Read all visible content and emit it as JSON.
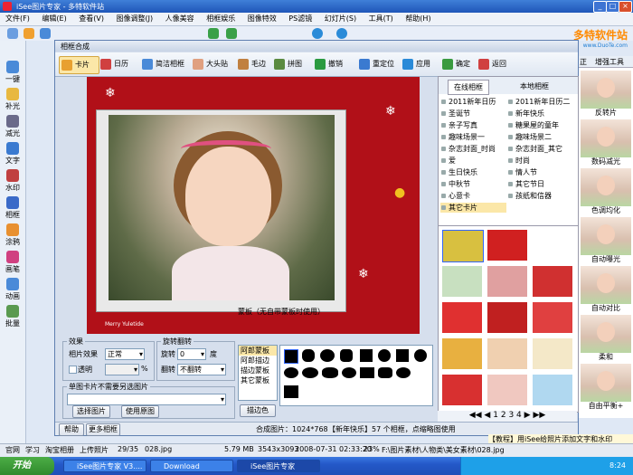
{
  "window": {
    "title": "iSee图片专家 - 多特软件站"
  },
  "menu": [
    "文件(F)",
    "编辑(E)",
    "查看(V)",
    "图像调整(J)",
    "人像美容",
    "相框娱乐",
    "图像特效",
    "PS滤镜",
    "幻灯片(S)",
    "工具(T)",
    "帮助(H)"
  ],
  "logo": {
    "main": "多特软件站",
    "sub": "www.DuoTe.com"
  },
  "left_tools": [
    "一键",
    "补光",
    "减光",
    "文字",
    "水印",
    "相框",
    "涂鸦",
    "画笔",
    "动画",
    "批量"
  ],
  "right_panel": {
    "tabs": [
      "正",
      "增强工具"
    ],
    "items": [
      "反转片",
      "数码减光",
      "色调均化",
      "自动曝光",
      "自动对比",
      "柔和",
      "自由平衡+"
    ]
  },
  "dialog": {
    "title": "相框合成",
    "tools": [
      "卡片",
      "日历",
      "简洁相框",
      "大头贴",
      "毛边",
      "拼图",
      "撤销",
      "重定位",
      "应用",
      "确定",
      "返回"
    ],
    "effect": {
      "legend": "效果",
      "label": "相片效果",
      "value": "正常",
      "transparent": "透明",
      "percent": "%"
    },
    "rotate": {
      "legend": "旋转翻转",
      "rotate_label": "旋转",
      "rotate_value": "0",
      "degree": "度",
      "flip_label": "翻转",
      "flip_value": "不翻转"
    },
    "card": {
      "legend": "单图卡片不需要另选图片",
      "choose": "选择图片",
      "use_original": "使用原图"
    },
    "mask": {
      "legend": "蒙板（无自带蒙板时使用）",
      "items": [
        "阿郎蒙板",
        "阿郎描边",
        "描边蒙板",
        "其它蒙板"
      ],
      "edge_color": "描边色"
    },
    "category_tabs": [
      "在线相框",
      "本地相框"
    ],
    "categories": [
      "2011新年日历",
      "2011新年日历二",
      "圣诞节",
      "新年快乐",
      "亲子写真",
      "糖果屋的童年",
      "趣味场景一",
      "趣味场景二",
      "杂志封面_时尚",
      "杂志封面_其它",
      "爱",
      "时尚",
      "生日快乐",
      "情人节",
      "中秋节",
      "其它节日",
      "心意卡",
      "孩纸和信器",
      "其它卡片"
    ],
    "pages": [
      "1",
      "2",
      "3",
      "4"
    ],
    "status": {
      "help": "帮助",
      "more": "更多相框",
      "size": "合成图片：1024*768",
      "info": "【新年快乐】57 个相框，点缩略图使用"
    },
    "canvas_caption": "Merry Yuletide"
  },
  "tip": "【教程】用iSee给照片添加文字和水印",
  "statusbar": {
    "site": "官网",
    "learn": "学习",
    "taobao": "淘宝相册",
    "upload": "上传照片",
    "count": "29/35",
    "file": "028.jpg",
    "filesize": "5.79 MB",
    "dims": "3543x3093",
    "date": "2008-07-31 02:33:20",
    "zoom": "23%",
    "path": "F:\\图片素材\\人物类\\美女素材\\028.jpg"
  },
  "taskbar": {
    "start": "开始",
    "tasks": [
      "iSee图片专家 V3....",
      "Download",
      "iSee图片专家"
    ],
    "time": "8:24"
  }
}
